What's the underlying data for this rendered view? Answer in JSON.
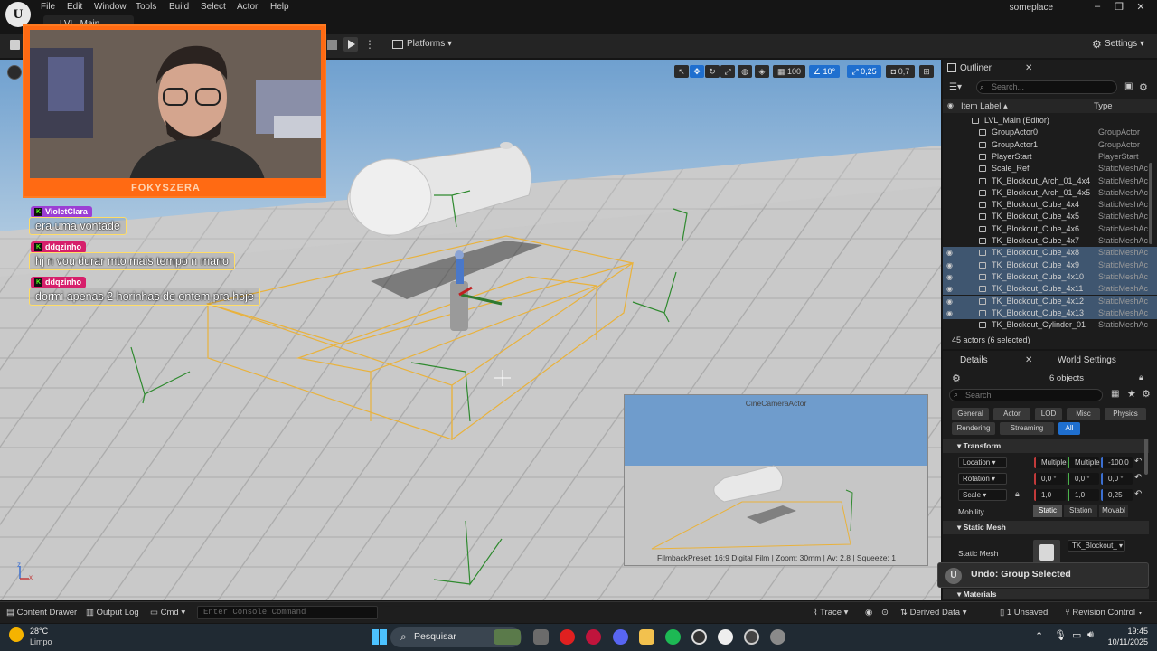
{
  "menu": {
    "items": [
      "File",
      "Edit",
      "Window",
      "Tools",
      "Build",
      "Select",
      "Actor",
      "Help"
    ],
    "project_name": "someplace",
    "logo_text": "U"
  },
  "level_tab": {
    "label": "LVL_Main"
  },
  "toolbar": {
    "platforms_label": "Platforms",
    "settings_label": "Settings"
  },
  "viewport": {
    "tools": {
      "grid_snap": "100",
      "rotation_snap": "10°",
      "scale_snap": "0,25",
      "camera_speed": "0,7"
    },
    "axis_labels": {
      "z": "z",
      "x": "x"
    }
  },
  "webcam": {
    "banner_text": "FOKYSZERA"
  },
  "chat": [
    {
      "user": "VioletClara",
      "message": "era uma vontade",
      "badge_color": "#9b3fd4"
    },
    {
      "user": "ddqzinho",
      "message": "hj n vou durar mto mais tempo n mano",
      "badge_color": "#d61f6b"
    },
    {
      "user": "ddqzinho",
      "message": "dormi apenas 2 horinhas de ontem pra hoje",
      "badge_color": "#d61f6b"
    }
  ],
  "camera_preview": {
    "title": "CineCameraActor",
    "info": "FilmbackPreset: 16:9 Digital Film | Zoom: 30mm | Av: 2,8 | Squeeze: 1"
  },
  "outliner": {
    "tab_label": "Outliner",
    "search_placeholder": "Search...",
    "col_label": "Item Label",
    "col_type": "Type",
    "rows": [
      {
        "label": "LVL_Main (Editor)",
        "type": "",
        "selected": false,
        "indent": 1
      },
      {
        "label": "GroupActor0",
        "type": "GroupActor",
        "selected": false,
        "indent": 2
      },
      {
        "label": "GroupActor1",
        "type": "GroupActor",
        "selected": false,
        "indent": 2
      },
      {
        "label": "PlayerStart",
        "type": "PlayerStart",
        "selected": false,
        "indent": 2
      },
      {
        "label": "Scale_Ref",
        "type": "StaticMeshAc",
        "selected": false,
        "indent": 2
      },
      {
        "label": "TK_Blockout_Arch_01_4x4",
        "type": "StaticMeshAc",
        "selected": false,
        "indent": 2
      },
      {
        "label": "TK_Blockout_Arch_01_4x5",
        "type": "StaticMeshAc",
        "selected": false,
        "indent": 2
      },
      {
        "label": "TK_Blockout_Cube_4x4",
        "type": "StaticMeshAc",
        "selected": false,
        "indent": 2
      },
      {
        "label": "TK_Blockout_Cube_4x5",
        "type": "StaticMeshAc",
        "selected": false,
        "indent": 2
      },
      {
        "label": "TK_Blockout_Cube_4x6",
        "type": "StaticMeshAc",
        "selected": false,
        "indent": 2
      },
      {
        "label": "TK_Blockout_Cube_4x7",
        "type": "StaticMeshAc",
        "selected": false,
        "indent": 2
      },
      {
        "label": "TK_Blockout_Cube_4x8",
        "type": "StaticMeshAc",
        "selected": true,
        "indent": 2
      },
      {
        "label": "TK_Blockout_Cube_4x9",
        "type": "StaticMeshAc",
        "selected": true,
        "indent": 2
      },
      {
        "label": "TK_Blockout_Cube_4x10",
        "type": "StaticMeshAc",
        "selected": true,
        "indent": 2
      },
      {
        "label": "TK_Blockout_Cube_4x11",
        "type": "StaticMeshAc",
        "selected": true,
        "indent": 2
      },
      {
        "label": "TK_Blockout_Cube_4x12",
        "type": "StaticMeshAc",
        "selected": true,
        "indent": 2
      },
      {
        "label": "TK_Blockout_Cube_4x13",
        "type": "StaticMeshAc",
        "selected": true,
        "indent": 2
      },
      {
        "label": "TK_Blockout_Cylinder_01",
        "type": "StaticMeshAc",
        "selected": false,
        "indent": 2
      }
    ],
    "count": "45 actors (6 selected)"
  },
  "details": {
    "tab_label": "Details",
    "world_settings_label": "World Settings",
    "objects_label": "6 objects",
    "search_placeholder": "Search",
    "filter_tabs": [
      "General",
      "Actor",
      "LOD",
      "Misc",
      "Physics",
      "Rendering",
      "Streaming",
      "All"
    ],
    "transform_header": "Transform",
    "location_label": "Location",
    "location": [
      "Multiple",
      "Multiple",
      "-100,0"
    ],
    "rotation_label": "Rotation",
    "rotation": [
      "0,0 °",
      "0,0 °",
      "0,0 °"
    ],
    "scale_label": "Scale",
    "scale": [
      "1,0",
      "1,0",
      "0,25"
    ],
    "mobility_label": "Mobility",
    "mobility_options": [
      "Static",
      "Station",
      "Movabl"
    ],
    "static_mesh_header": "Static Mesh",
    "static_mesh_label": "Static Mesh",
    "static_mesh_value": "TK_Blockout_",
    "materials_header": "Materials"
  },
  "toast": {
    "text": "Undo: Group Selected"
  },
  "statusbar": {
    "content_drawer": "Content Drawer",
    "output_log": "Output Log",
    "cmd": "Cmd",
    "console_placeholder": "Enter Console Command",
    "trace": "Trace",
    "derived_data": "Derived Data",
    "unsaved": "1 Unsaved",
    "revision_control": "Revision Control"
  },
  "taskbar": {
    "temperature": "28°C",
    "weather": "Limpo",
    "search_label": "Pesquisar",
    "time": "19:45",
    "date": "10/11/2025"
  }
}
